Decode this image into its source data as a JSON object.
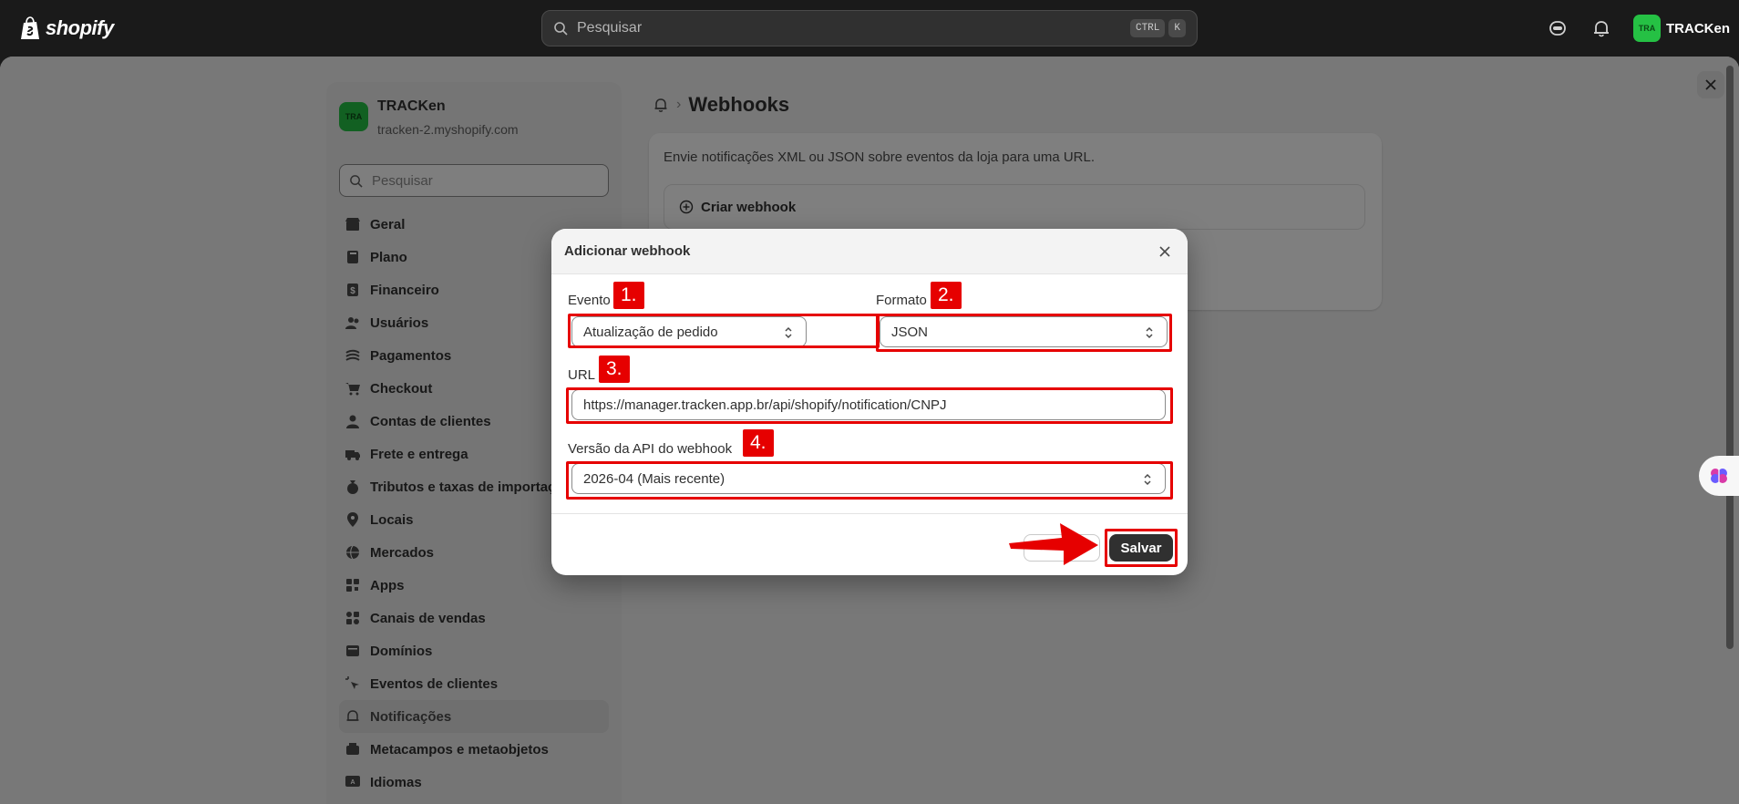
{
  "topbar": {
    "logo_text": "shopify",
    "search_placeholder": "Pesquisar",
    "shortcut_keys": [
      "CTRL",
      "K"
    ],
    "store_chip": {
      "avatar": "TRA",
      "name": "TRACKen"
    }
  },
  "sidebar": {
    "store": {
      "avatar": "TRA",
      "name": "TRACKen",
      "url": "tracken-2.myshopify.com"
    },
    "search_placeholder": "Pesquisar",
    "items": [
      {
        "label": "Geral",
        "icon": "store-icon"
      },
      {
        "label": "Plano",
        "icon": "plan-icon"
      },
      {
        "label": "Financeiro",
        "icon": "billing-icon"
      },
      {
        "label": "Usuários",
        "icon": "users-icon"
      },
      {
        "label": "Pagamentos",
        "icon": "payments-icon"
      },
      {
        "label": "Checkout",
        "icon": "cart-icon"
      },
      {
        "label": "Contas de clientes",
        "icon": "person-icon"
      },
      {
        "label": "Frete e entrega",
        "icon": "truck-icon"
      },
      {
        "label": "Tributos e taxas de importação",
        "icon": "taxes-icon"
      },
      {
        "label": "Locais",
        "icon": "location-icon"
      },
      {
        "label": "Mercados",
        "icon": "globe-icon"
      },
      {
        "label": "Apps",
        "icon": "apps-icon"
      },
      {
        "label": "Canais de vendas",
        "icon": "channels-icon"
      },
      {
        "label": "Domínios",
        "icon": "domain-icon"
      },
      {
        "label": "Eventos de clientes",
        "icon": "cursor-icon"
      },
      {
        "label": "Notificações",
        "icon": "bell-icon",
        "active": true
      },
      {
        "label": "Metacampos e metaobjetos",
        "icon": "metafields-icon"
      },
      {
        "label": "Idiomas",
        "icon": "language-icon"
      }
    ]
  },
  "content": {
    "breadcrumb_separator": "›",
    "title": "Webhooks",
    "description": "Envie notificações XML ou JSON sobre eventos da loja para uma URL.",
    "create_label": "Criar webhook"
  },
  "modal": {
    "title": "Adicionar webhook",
    "event": {
      "label": "Evento",
      "value": "Atualização de pedido",
      "badge": "1."
    },
    "format": {
      "label": "Formato",
      "value": "JSON",
      "badge": "2."
    },
    "url": {
      "label": "URL",
      "value": "https://manager.tracken.app.br/api/shopify/notification/CNPJ",
      "badge": "3."
    },
    "api_version": {
      "label": "Versão da API do webhook",
      "value": "2026-04 (Mais recente)",
      "badge": "4."
    },
    "save_label": "Salvar"
  },
  "colors": {
    "accent_red": "#e60000",
    "avatar_green": "#25c144",
    "save_bg": "#303030"
  }
}
